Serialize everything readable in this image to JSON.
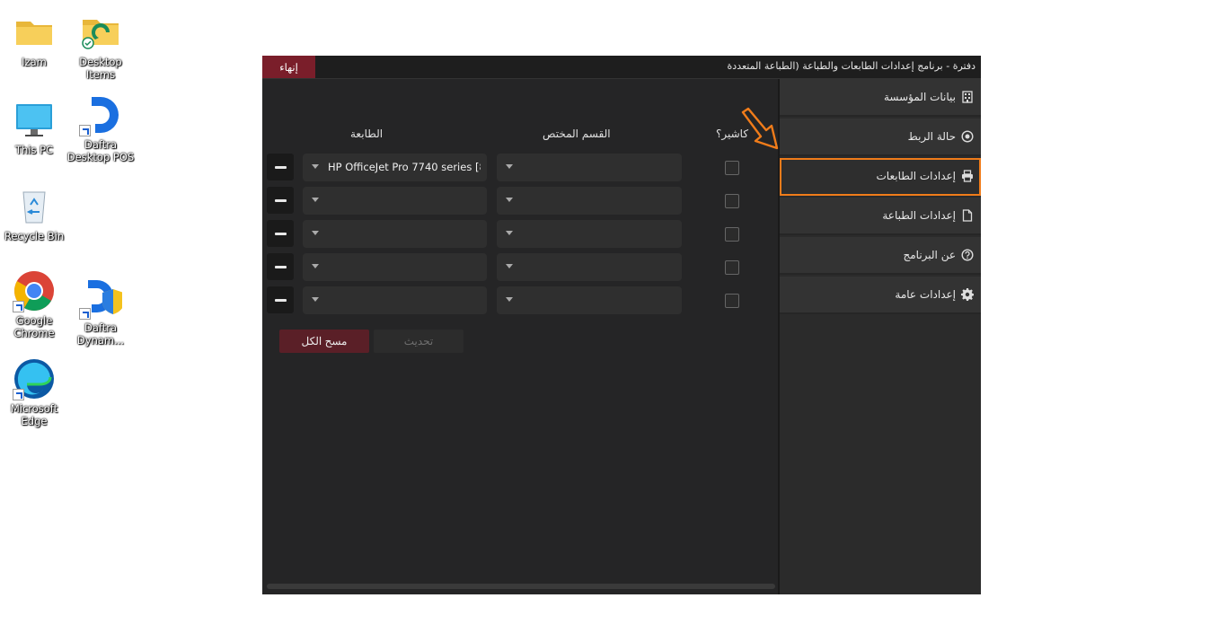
{
  "desktop": {
    "icons": [
      {
        "label": "Izam"
      },
      {
        "label": "Desktop Items"
      },
      {
        "label": "This PC"
      },
      {
        "label": "Daftra Desktop POS"
      },
      {
        "label": "Recycle Bin"
      },
      {
        "label": "Google Chrome"
      },
      {
        "label": "Daftra Dynam..."
      },
      {
        "label": "Microsoft Edge"
      }
    ]
  },
  "window": {
    "title": "دفترة - برنامج إعدادات الطابعات والطباعة (الطباعة المتعددة",
    "exit_label": "إنهاء"
  },
  "sidebar": {
    "items": [
      {
        "label": "بيانات المؤسسة",
        "icon": "building-icon"
      },
      {
        "label": "حالة الربط",
        "icon": "radio-dot-icon"
      },
      {
        "label": "إعدادات الطابعات",
        "icon": "printer-icon",
        "active": true
      },
      {
        "label": "إعدادات الطباعة",
        "icon": "file-icon"
      },
      {
        "label": "عن البرنامج",
        "icon": "question-circle-icon"
      },
      {
        "label": "إعدادات عامة",
        "icon": "gear-icon"
      }
    ]
  },
  "table": {
    "headers": {
      "cashier": "كاشير؟",
      "department": "القسم المختص",
      "printer": "الطابعة"
    },
    "rows": [
      {
        "printer": "HP OfficeJet Pro 7740 series [8...",
        "department": "",
        "cashier": false
      },
      {
        "printer": "",
        "department": "",
        "cashier": false
      },
      {
        "printer": "",
        "department": "",
        "cashier": false
      },
      {
        "printer": "",
        "department": "",
        "cashier": false
      },
      {
        "printer": "",
        "department": "",
        "cashier": false
      }
    ]
  },
  "actions": {
    "clear_all": "مسح الكل",
    "refresh": "تحديث"
  },
  "colors": {
    "highlight": "#f07c1a",
    "exit": "#7a1e2a",
    "clear": "#5a1f27"
  }
}
